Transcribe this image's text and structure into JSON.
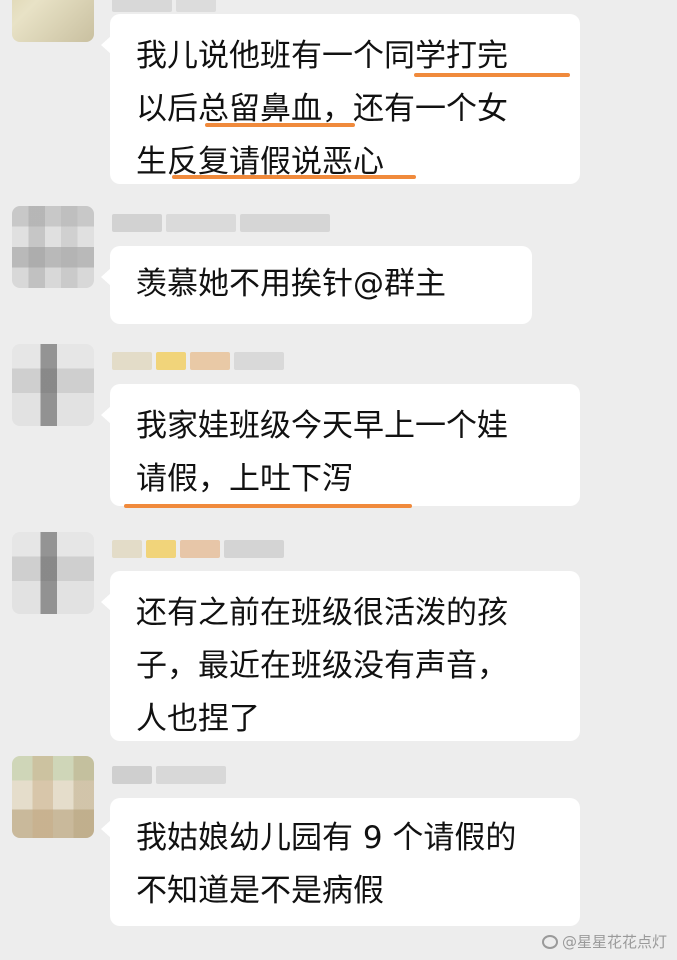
{
  "messages": [
    {
      "lines": [
        "我儿说他班有一个同学打完",
        "以后总留鼻血，还有一个女",
        "生反复请假说恶心"
      ]
    },
    {
      "lines": [
        "羡慕她不用挨针@群主"
      ]
    },
    {
      "lines": [
        "我家娃班级今天早上一个娃",
        "请假，上吐下泻"
      ]
    },
    {
      "lines": [
        "还有之前在班级很活泼的孩",
        "子，最近在班级没有声音，",
        "人也捏了"
      ]
    },
    {
      "lines": [
        "我姑娘幼儿园有 9 个请假的",
        "不知道是不是病假"
      ]
    }
  ],
  "watermark": {
    "text": "@星星花花点灯"
  },
  "colors": {
    "background": "#ededed",
    "bubble": "#ffffff",
    "underline": "#f08a3c"
  }
}
